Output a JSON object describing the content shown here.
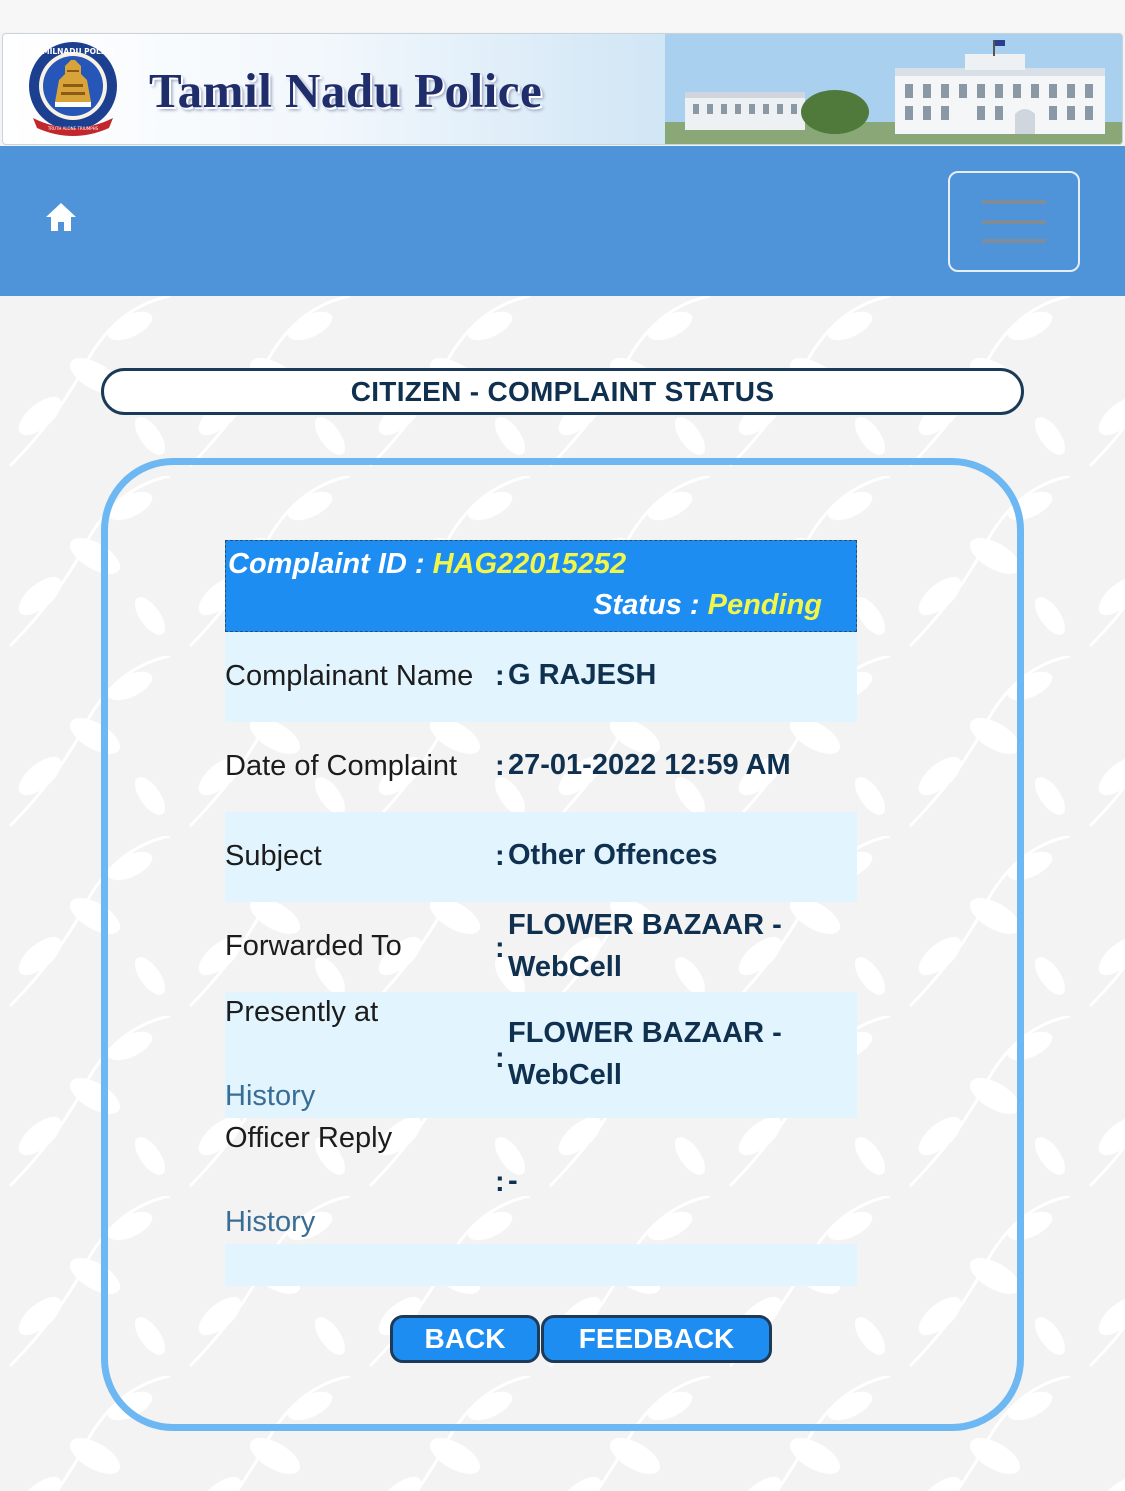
{
  "header": {
    "title": "Tamil Nadu Police",
    "emblem_text": "TAMILNADU POLICE",
    "emblem_motto": "TRUTH ALONE TRIUMPHS"
  },
  "navbar": {
    "home_icon": "home-icon",
    "menu_icon": "hamburger-menu-icon"
  },
  "page": {
    "title": "CITIZEN - COMPLAINT STATUS"
  },
  "complaint": {
    "id_label": "Complaint ID : ",
    "id_value": "HAG22015252",
    "status_label": "Status : ",
    "status_value": "Pending",
    "rows": [
      {
        "label": "Complainant Name",
        "colon": ":",
        "value": "G RAJESH"
      },
      {
        "label": "Date of Complaint",
        "colon": ":",
        "value": "27-01-2022 12:59 AM"
      },
      {
        "label": "Subject",
        "colon": ":",
        "value": "Other Offences"
      },
      {
        "label": "Forwarded To",
        "colon": ":",
        "value": "FLOWER BAZAAR - WebCell"
      },
      {
        "label": "Presently at",
        "colon": ":",
        "value": "FLOWER BAZAAR - WebCell",
        "link": "History"
      },
      {
        "label": "Officer Reply",
        "colon": ":",
        "value": "-",
        "link": "History"
      }
    ]
  },
  "buttons": {
    "back": "BACK",
    "feedback": "FEEDBACK"
  },
  "colors": {
    "navbar": "#4f94d9",
    "id_box": "#1e8df2",
    "highlight": "#f3f64a",
    "card_border": "#6db7f2",
    "row_shade": "#e2f4fd"
  }
}
